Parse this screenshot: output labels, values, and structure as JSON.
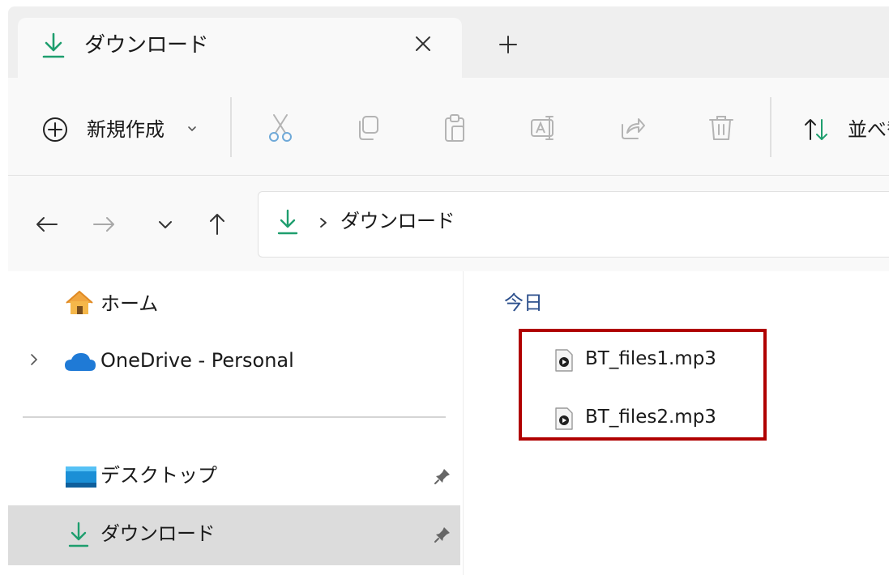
{
  "tab": {
    "title": "ダウンロード"
  },
  "toolbar": {
    "new_label": "新規作成",
    "sort_label": "並べ替え"
  },
  "address": {
    "current": "ダウンロード"
  },
  "sidebar": {
    "items": [
      {
        "label": "ホーム",
        "icon": "home-icon"
      },
      {
        "label": "OneDrive - Personal",
        "icon": "cloud-icon"
      },
      {
        "label": "デスクトップ",
        "icon": "desktop-icon",
        "pinned": true
      },
      {
        "label": "ダウンロード",
        "icon": "download-icon",
        "pinned": true,
        "selected": true
      }
    ]
  },
  "content": {
    "group_header": "今日",
    "files": [
      {
        "name": "BT_files1.mp3",
        "icon": "audio-file-icon"
      },
      {
        "name": "BT_files2.mp3",
        "icon": "audio-file-icon"
      }
    ]
  },
  "colors": {
    "accent_green": "#1e9e6e",
    "highlight_red": "#b00000",
    "group_header_blue": "#2c4f8c",
    "selection_gray": "#dcdcdc"
  }
}
